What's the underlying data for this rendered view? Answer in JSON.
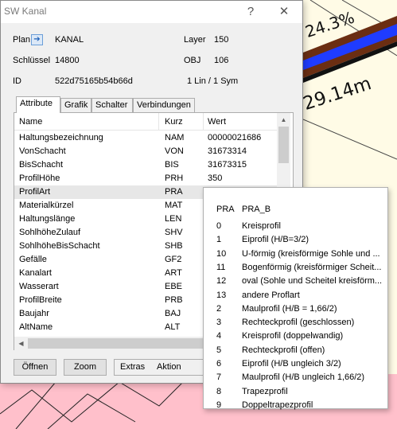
{
  "window": {
    "title": "SW Kanal",
    "help": "?",
    "close": "✕"
  },
  "info": {
    "plan_label": "Plan",
    "plan_value": "KANAL",
    "layer_label": "Layer",
    "layer_value": "150",
    "key_label": "Schlüssel",
    "key_value": "14800",
    "obj_label": "OBJ",
    "obj_value": "106",
    "id_label": "ID",
    "id_value": "522d75165b54b66d",
    "lin_sym": "1 Lin / 1 Sym"
  },
  "tabs": [
    {
      "label": "Attribute"
    },
    {
      "label": "Grafik"
    },
    {
      "label": "Schalter"
    },
    {
      "label": "Verbindungen"
    }
  ],
  "table": {
    "headers": {
      "name": "Name",
      "kurz": "Kurz",
      "wert": "Wert"
    },
    "rows": [
      {
        "name": "Haltungsbezeichnung",
        "kurz": "NAM",
        "wert": "00000021686"
      },
      {
        "name": "VonSchacht",
        "kurz": "VON",
        "wert": "31673314"
      },
      {
        "name": "BisSchacht",
        "kurz": "BIS",
        "wert": "31673315"
      },
      {
        "name": "ProfilHöhe",
        "kurz": "PRH",
        "wert": "350"
      },
      {
        "name": "ProfilArt",
        "kurz": "PRA",
        "wert": ""
      },
      {
        "name": "Materialkürzel",
        "kurz": "MAT",
        "wert": ""
      },
      {
        "name": "Haltungslänge",
        "kurz": "LEN",
        "wert": ""
      },
      {
        "name": "SohlhöheZulauf",
        "kurz": "SHV",
        "wert": ""
      },
      {
        "name": "SohlhöheBisSchacht",
        "kurz": "SHB",
        "wert": ""
      },
      {
        "name": "Gefälle",
        "kurz": "GF2",
        "wert": ""
      },
      {
        "name": "Kanalart",
        "kurz": "ART",
        "wert": ""
      },
      {
        "name": "Wasserart",
        "kurz": "EBE",
        "wert": ""
      },
      {
        "name": "ProfilBreite",
        "kurz": "PRB",
        "wert": ""
      },
      {
        "name": "Baujahr",
        "kurz": "BAJ",
        "wert": ""
      },
      {
        "name": "AltName",
        "kurz": "ALT",
        "wert": ""
      }
    ],
    "selected_row": "ProfilArt"
  },
  "buttons": {
    "open": "Öffnen",
    "zoom": "Zoom",
    "extras": "Extras",
    "aktion": "Aktion"
  },
  "popup": {
    "headers": {
      "code": "PRA",
      "desc": "PRA_B"
    },
    "options": [
      {
        "code": "0",
        "desc": "Kreisprofil"
      },
      {
        "code": "1",
        "desc": "Eiprofil (H/B=3/2)"
      },
      {
        "code": "10",
        "desc": "U-förmig (kreisförmige Sohle und ..."
      },
      {
        "code": "11",
        "desc": "Bogenförmig (kreisförmiger Scheit..."
      },
      {
        "code": "12",
        "desc": "oval (Sohle und Scheitel kreisförm..."
      },
      {
        "code": "13",
        "desc": "andere Proflart"
      },
      {
        "code": "2",
        "desc": "Maulprofil (H/B = 1,66/2)"
      },
      {
        "code": "3",
        "desc": "Rechteckprofil (geschlossen)"
      },
      {
        "code": "4",
        "desc": "Kreisprofil (doppelwandig)"
      },
      {
        "code": "5",
        "desc": "Rechteckprofil (offen)"
      },
      {
        "code": "6",
        "desc": "Eiprofil (H/B ungleich 3/2)"
      },
      {
        "code": "7",
        "desc": "Maulprofil (H/B ungleich 1,66/2)"
      },
      {
        "code": "8",
        "desc": "Trapezprofil"
      },
      {
        "code": "9",
        "desc": "Doppeltrapezprofil"
      }
    ]
  },
  "map": {
    "slope_label": "24.3%",
    "length_label": "29.14m"
  },
  "colors": {
    "map_background": "#fffbe6",
    "pipe_brown": "#6b2e12",
    "pipe_blue": "#1f3cff",
    "parcel_pink": "#ffc0cb"
  }
}
